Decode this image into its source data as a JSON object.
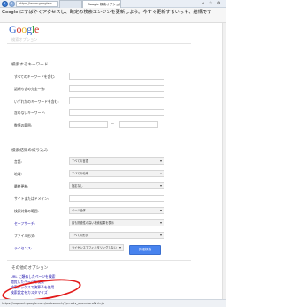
{
  "browser": {
    "address_text": "https://www.google.c...",
    "tab1_label": "",
    "tab2_label": "Google 検索オプション"
  },
  "notice": {
    "text": "Google にすばやくアクセスし、既定の検索エンジンを更新しよう。今すぐ更新するいっそ、結構です"
  },
  "header": {
    "logo": {
      "g1": "G",
      "o1": "o",
      "o2": "o",
      "g2": "g",
      "l": "l",
      "e": "e"
    },
    "subtitle": "検索オプション"
  },
  "find_section": {
    "title": "検索するキーワード",
    "fields": [
      {
        "label": "すべてのキーワードを含む:",
        "value": ""
      },
      {
        "label": "語順も含め完全一致:",
        "value": ""
      },
      {
        "label": "いずれかのキーワードを含む:",
        "value": ""
      },
      {
        "label": "含めないキーワード:",
        "value": ""
      },
      {
        "label": "数値の範囲:",
        "value": "",
        "separator": "—"
      }
    ]
  },
  "narrow_section": {
    "title": "検索結果の絞り込み",
    "rows": [
      {
        "label": "言語:",
        "value": "すべての言語",
        "link": false
      },
      {
        "label": "地域:",
        "value": "すべての地域",
        "link": false
      },
      {
        "label": "最終更新:",
        "value": "指定なし",
        "link": false
      },
      {
        "label": "サイトまたはドメイン:",
        "value": "",
        "link": false
      },
      {
        "label": "検索対象の範囲:",
        "value": "ページ全体",
        "link": false
      },
      {
        "label": "セーフサーチ:",
        "value": "最も関連性の高い検索結果を表示",
        "link": true
      },
      {
        "label": "ファイル形式:",
        "value": "すべての形式",
        "link": false
      },
      {
        "label": "ライセンス:",
        "value": "ライセンスでフィルタリングしない",
        "link": true
      }
    ],
    "search_button": "詳細検索"
  },
  "other_section": {
    "title": "その他のオプション",
    "links": [
      "URL に類似したページを検索",
      "閲覧したページを検索",
      "検索ボックスで演算子を使用",
      "検索設定をカスタマイズ"
    ]
  },
  "status_bar": {
    "url": "https://support.google.com/websearch/?p=adv_operators&hl=ja"
  },
  "colors": {
    "annotation": "#e21b1b",
    "link": "#1a0dab",
    "button": "#4883ee"
  }
}
